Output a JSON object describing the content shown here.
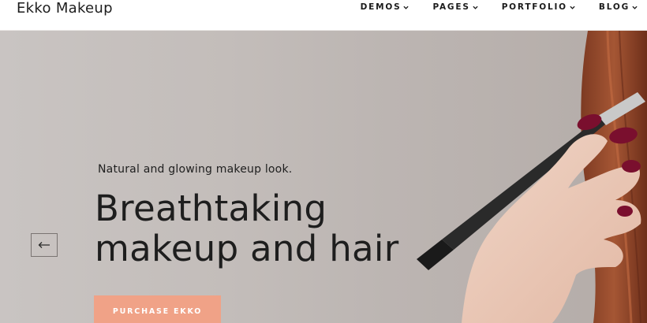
{
  "header": {
    "logo": "Ekko Makeup",
    "nav": [
      {
        "label": "DEMOS"
      },
      {
        "label": "PAGES"
      },
      {
        "label": "PORTFOLIO"
      },
      {
        "label": "BLOG"
      }
    ]
  },
  "hero": {
    "kicker": "Natural and glowing makeup look.",
    "headline_line1": "Breathtaking",
    "headline_line2": "makeup and hair",
    "cta_label": "PURCHASE EKKO"
  },
  "colors": {
    "accent": "#f0a287",
    "nail": "#7a0f2e",
    "hair": "#9a4a2c"
  },
  "icons": {
    "prev": "arrow-left-icon",
    "dropdown": "chevron-down-icon"
  }
}
